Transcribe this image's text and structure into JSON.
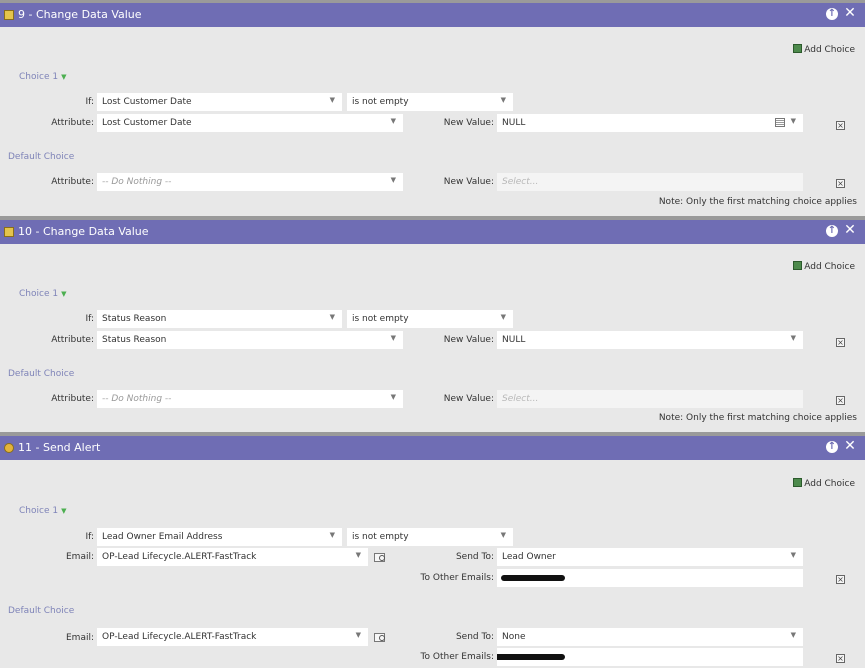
{
  "steps": [
    {
      "title": "9 - Change Data Value",
      "add_choice": "Add Choice",
      "choice1": {
        "label": "Choice 1",
        "if_label": "If:",
        "if_field": "Lost Customer Date",
        "operator": "is not empty",
        "attribute_label": "Attribute:",
        "attribute": "Lost Customer Date",
        "new_value_label": "New Value:",
        "new_value": "NULL"
      },
      "default": {
        "label": "Default Choice",
        "attribute_label": "Attribute:",
        "attribute": "-- Do Nothing --",
        "new_value_label": "New Value:",
        "new_value_placeholder": "Select..."
      },
      "note": "Note: Only the first matching choice applies"
    },
    {
      "title": "10 - Change Data Value",
      "add_choice": "Add Choice",
      "choice1": {
        "label": "Choice 1",
        "if_label": "If:",
        "if_field": "Status Reason",
        "operator": "is not empty",
        "attribute_label": "Attribute:",
        "attribute": "Status Reason",
        "new_value_label": "New Value:",
        "new_value": "NULL"
      },
      "default": {
        "label": "Default Choice",
        "attribute_label": "Attribute:",
        "attribute": "-- Do Nothing --",
        "new_value_label": "New Value:",
        "new_value_placeholder": "Select..."
      },
      "note": "Note: Only the first matching choice applies"
    },
    {
      "title": "11 - Send Alert",
      "add_choice": "Add Choice",
      "choice1": {
        "label": "Choice 1",
        "if_label": "If:",
        "if_field": "Lead Owner Email Address",
        "operator": "is not empty",
        "email_label": "Email:",
        "email": "OP-Lead Lifecycle.ALERT-FastTrack",
        "send_to_label": "Send To:",
        "send_to": "Lead Owner",
        "other_emails_label": "To Other Emails:"
      },
      "default": {
        "label": "Default Choice",
        "email_label": "Email:",
        "email": "OP-Lead Lifecycle.ALERT-FastTrack",
        "send_to_label": "Send To:",
        "send_to": "None",
        "other_emails_label": "To Other Emails:"
      }
    }
  ],
  "icons": {
    "step_change": "change-data-value-icon",
    "step_alert": "send-alert-icon",
    "move_up": "move-up-icon",
    "close": "close-icon",
    "add_choice": "add-choice-icon",
    "dropdown": "chevron-down-icon",
    "calendar": "calendar-icon",
    "delete": "delete-choice-icon",
    "preview": "preview-email-icon"
  },
  "colors": {
    "header": "#6f6db4",
    "choice_label": "#7f84b8",
    "panel": "#e8e8e8"
  }
}
